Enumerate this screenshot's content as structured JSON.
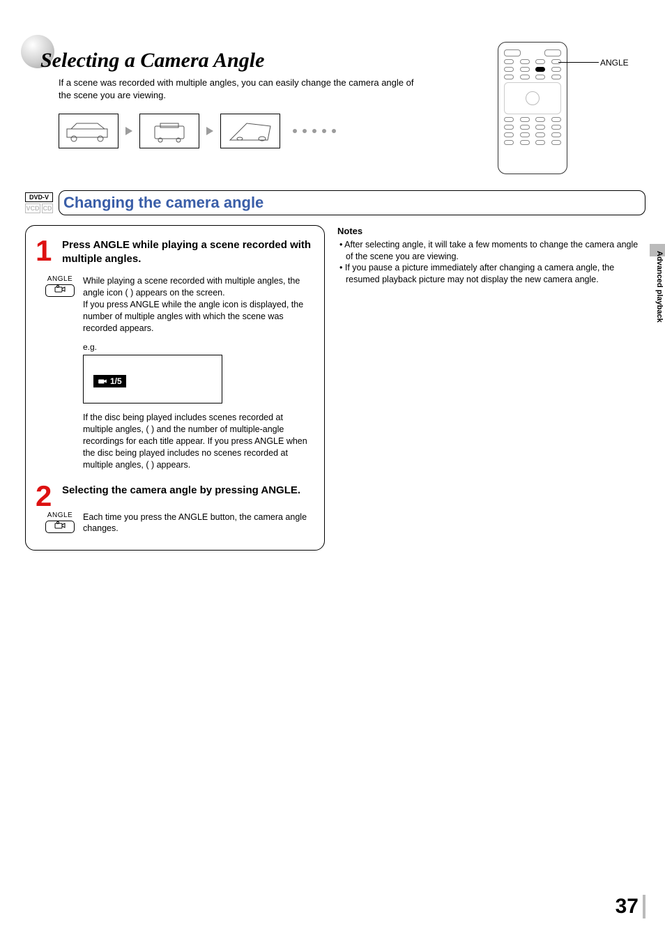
{
  "side_tab": "Advanced playback",
  "header": {
    "title": "Selecting a Camera Angle",
    "intro": "If a scene was recorded with multiple angles, you can easily change the camera angle of the scene you are viewing."
  },
  "remote": {
    "callout": "ANGLE"
  },
  "section": {
    "badges": {
      "dvd": "DVD-V",
      "vcd": "VCD",
      "cd": "CD"
    },
    "title": "Changing the camera angle"
  },
  "steps": {
    "one": {
      "num": "1",
      "head": "Press ANGLE while playing a scene recorded with multiple angles.",
      "btn_label": "ANGLE",
      "para1": "While playing a scene recorded with multiple angles, the angle icon (   ) appears on the screen.\nIf you press ANGLE while the angle icon is displayed, the number of multiple angles with which the scene was recorded appears.",
      "eg_label": "e.g.",
      "eg_chip": "1/5",
      "para2": "If the disc being played includes scenes recorded at multiple angles, (   ) and the number of multiple-angle recordings for each title appear. If you press ANGLE when the disc being played includes no scenes recorded at multiple angles, (   ) appears."
    },
    "two": {
      "num": "2",
      "head": "Selecting the camera angle by pressing ANGLE.",
      "btn_label": "ANGLE",
      "para": "Each time you press the ANGLE button, the camera angle changes."
    }
  },
  "notes": {
    "heading": "Notes",
    "items": [
      "After selecting angle, it will take a few moments to change the camera angle of the scene you are viewing.",
      "If you pause a picture immediately after changing a camera angle, the resumed playback picture may not display the new camera angle."
    ]
  },
  "page_number": "37"
}
